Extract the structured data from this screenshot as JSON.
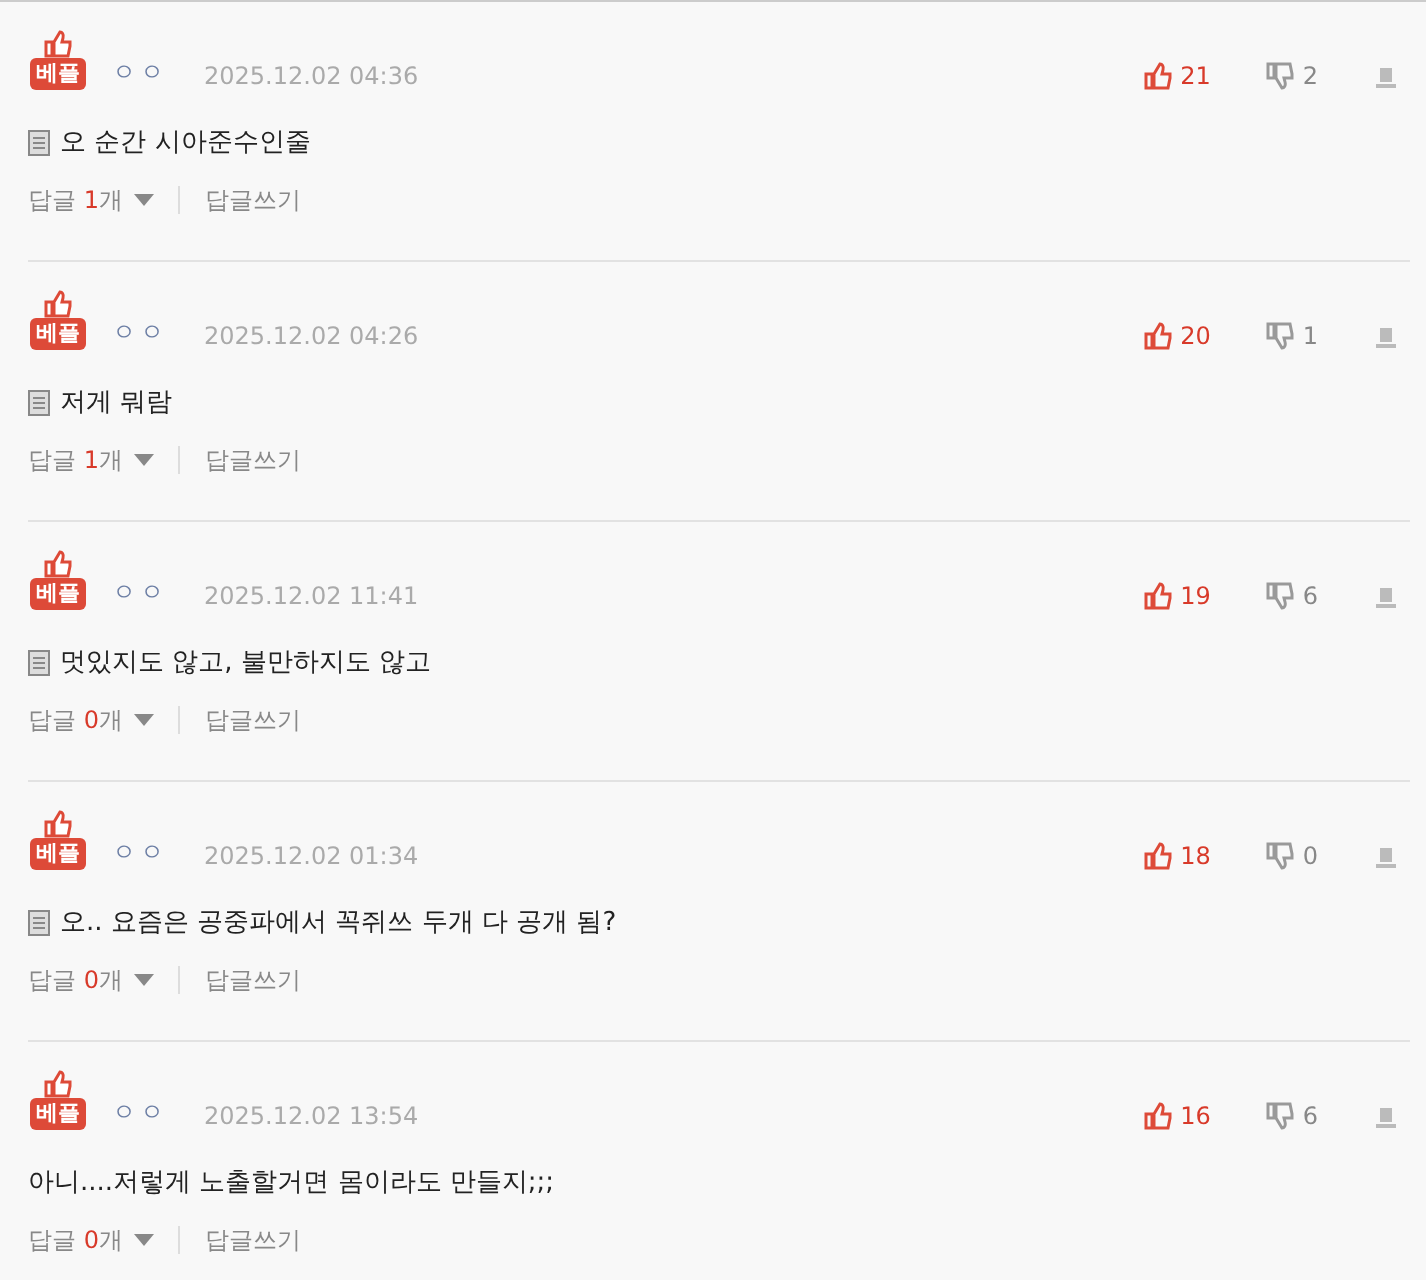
{
  "comments": [
    {
      "badge": "베플",
      "nickname": "ㅇㅇ",
      "date": "2025.12.02 04:36",
      "likes": "21",
      "dislikes": "2",
      "attachment": true,
      "text": "오 순간 시아준수인줄",
      "reply_label": "답글",
      "reply_count": "1",
      "reply_unit": "개",
      "write_reply": "답글쓰기"
    },
    {
      "badge": "베플",
      "nickname": "ㅇㅇ",
      "date": "2025.12.02 04:26",
      "likes": "20",
      "dislikes": "1",
      "attachment": true,
      "text": "저게 뭐람",
      "reply_label": "답글",
      "reply_count": "1",
      "reply_unit": "개",
      "write_reply": "답글쓰기"
    },
    {
      "badge": "베플",
      "nickname": "ㅇㅇ",
      "date": "2025.12.02 11:41",
      "likes": "19",
      "dislikes": "6",
      "attachment": true,
      "text": "멋있지도 않고, 불만하지도 않고",
      "reply_label": "답글",
      "reply_count": "0",
      "reply_unit": "개",
      "write_reply": "답글쓰기"
    },
    {
      "badge": "베플",
      "nickname": "ㅇㅇ",
      "date": "2025.12.02 01:34",
      "likes": "18",
      "dislikes": "0",
      "attachment": true,
      "text": "오.. 요즘은 공중파에서 꼭쥐쓰 두개 다 공개 됨?",
      "reply_label": "답글",
      "reply_count": "0",
      "reply_unit": "개",
      "write_reply": "답글쓰기"
    },
    {
      "badge": "베플",
      "nickname": "ㅇㅇ",
      "date": "2025.12.02 13:54",
      "likes": "16",
      "dislikes": "6",
      "attachment": false,
      "text": "아니....저렇게 노출할거면 몸이라도 만들지;;;",
      "reply_label": "답글",
      "reply_count": "0",
      "reply_unit": "개",
      "write_reply": "답글쓰기"
    }
  ]
}
